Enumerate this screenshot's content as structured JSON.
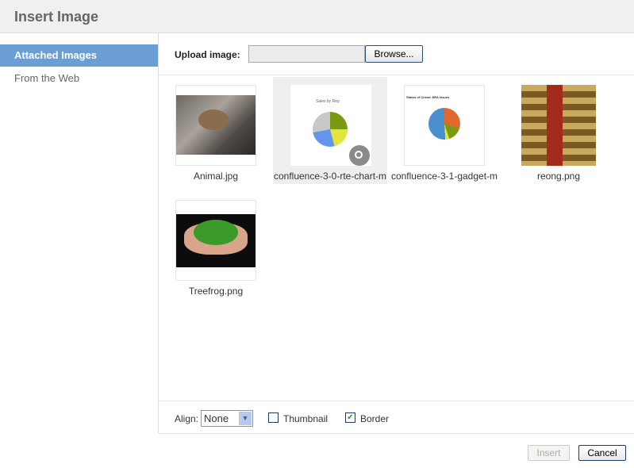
{
  "dialog": {
    "title": "Insert Image"
  },
  "sidebar": {
    "items": [
      {
        "label": "Attached Images",
        "active": true
      },
      {
        "label": "From the Web",
        "active": false
      }
    ]
  },
  "upload": {
    "label": "Upload image:",
    "value": "",
    "browse_label": "Browse..."
  },
  "images": [
    {
      "name": "Animal.jpg"
    },
    {
      "name": "confluence-3-0-rte-chart-m",
      "hovered": true,
      "chart_title": "Sales by Rep"
    },
    {
      "name": "confluence-3-1-gadget-m",
      "chart_title": "Status of Crowd JIRA Issues"
    },
    {
      "name": "reong.png"
    },
    {
      "name": "Treefrog.png"
    }
  ],
  "options": {
    "align_label": "Align:",
    "align_value": "None",
    "thumbnail_label": "Thumbnail",
    "thumbnail_checked": false,
    "border_label": "Border",
    "border_checked": true
  },
  "footer": {
    "insert_label": "Insert",
    "cancel_label": "Cancel"
  },
  "colors": {
    "accent": "#6b9fd3"
  }
}
